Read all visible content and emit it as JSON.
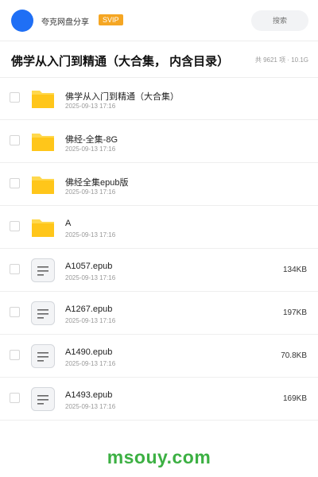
{
  "header": {
    "app_name": "夸克网盘分享",
    "badge": "SVIP",
    "search_placeholder": "搜索",
    "avatar_color": "#1f6ff5"
  },
  "folder": {
    "title": "佛学从入门到精通（大合集， 内含目录）",
    "meta": "共 9621 项 · 10.1G"
  },
  "items": [
    {
      "type": "folder",
      "icon": "folder-icon",
      "name": "佛学从入门到精通（大合集）",
      "date": "2025-09-13 17:16",
      "size": ""
    },
    {
      "type": "folder",
      "icon": "folder-icon",
      "name": "佛经-全集-8G",
      "date": "2025-09-13 17:16",
      "size": ""
    },
    {
      "type": "folder",
      "icon": "folder-icon",
      "name": "佛经全集epub版",
      "date": "2025-09-13 17:16",
      "size": ""
    },
    {
      "type": "folder",
      "icon": "folder-icon",
      "name": "A",
      "date": "2025-09-13 17:16",
      "size": ""
    },
    {
      "type": "file",
      "icon": "document-icon",
      "name": "A1057.epub",
      "date": "2025-09-13 17:16",
      "size": "134KB"
    },
    {
      "type": "file",
      "icon": "document-icon",
      "name": "A1267.epub",
      "date": "2025-09-13 17:16",
      "size": "197KB"
    },
    {
      "type": "file",
      "icon": "document-icon",
      "name": "A1490.epub",
      "date": "2025-09-13 17:16",
      "size": "70.8KB"
    },
    {
      "type": "file",
      "icon": "document-icon",
      "name": "A1493.epub",
      "date": "2025-09-13 17:16",
      "size": "169KB"
    }
  ],
  "watermark": "msouy.com",
  "colors": {
    "folder": "#ffc61a",
    "folder_tab": "#ffd84d",
    "badge": "#f5a623",
    "watermark": "#3cb043"
  }
}
